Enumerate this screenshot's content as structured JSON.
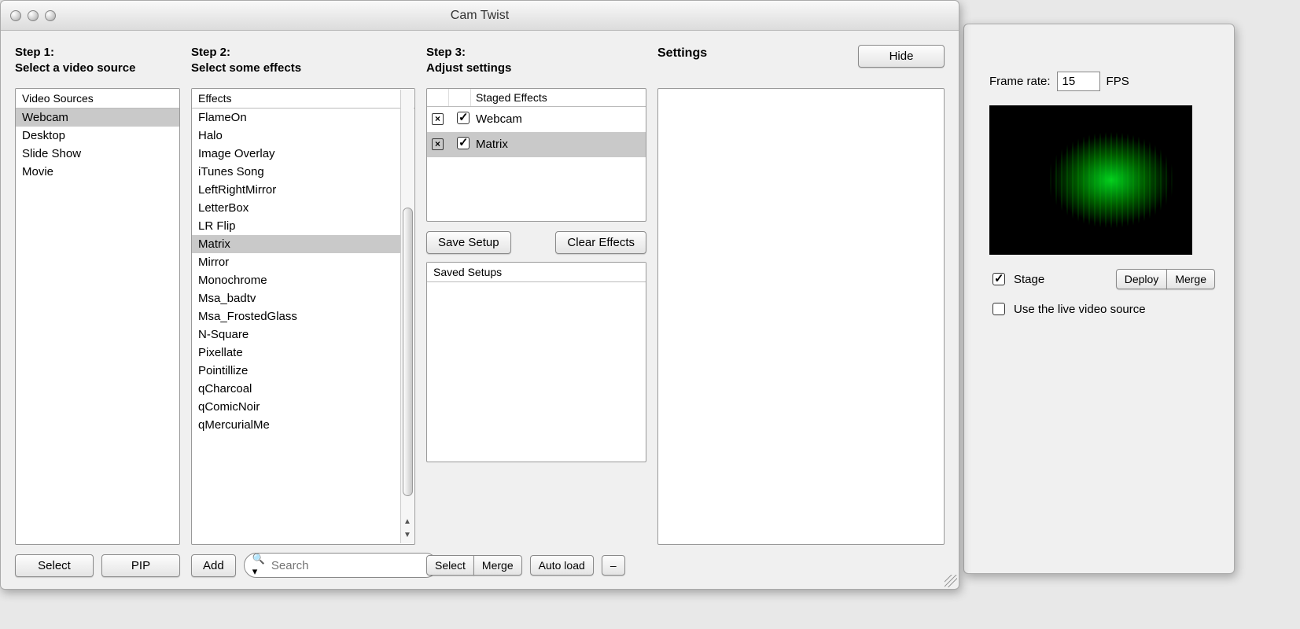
{
  "window": {
    "title": "Cam Twist"
  },
  "step1": {
    "heading": "Step 1:\nSelect a video source",
    "list_header": "Video Sources",
    "items": [
      "Webcam",
      "Desktop",
      "Slide Show",
      "Movie"
    ],
    "selected": "Webcam"
  },
  "step2": {
    "heading": "Step 2:\nSelect some effects",
    "list_header": "Effects",
    "items": [
      "FlameOn",
      "Halo",
      "Image Overlay",
      "iTunes Song",
      "LeftRightMirror",
      "LetterBox",
      "LR Flip",
      "Matrix",
      "Mirror",
      "Monochrome",
      "Msa_badtv",
      "Msa_FrostedGlass",
      "N-Square",
      "Pixellate",
      "Pointillize",
      "qCharcoal",
      "qComicNoir",
      "qMercurialMe"
    ],
    "selected": "Matrix"
  },
  "step3": {
    "heading": "Step 3:\nAdjust settings",
    "staged_header": "Staged Effects",
    "staged": [
      {
        "name": "Webcam",
        "enabled": true,
        "selected": false
      },
      {
        "name": "Matrix",
        "enabled": true,
        "selected": true
      }
    ],
    "save_setup": "Save Setup",
    "clear_effects": "Clear Effects",
    "saved_header": "Saved Setups"
  },
  "settings": {
    "title": "Settings",
    "hide": "Hide"
  },
  "buttons": {
    "select": "Select",
    "pip": "PIP",
    "add": "Add",
    "search_placeholder": "Search",
    "select2": "Select",
    "merge": "Merge",
    "autoload": "Auto load",
    "dash": "–",
    "deploy": "Deploy",
    "merge2": "Merge"
  },
  "preview_panel": {
    "frame_rate_label": "Frame rate:",
    "frame_rate_value": "15",
    "fps_suffix": "FPS",
    "stage_label": "Stage",
    "stage_checked": true,
    "live_label": "Use the live video source",
    "live_checked": false
  }
}
